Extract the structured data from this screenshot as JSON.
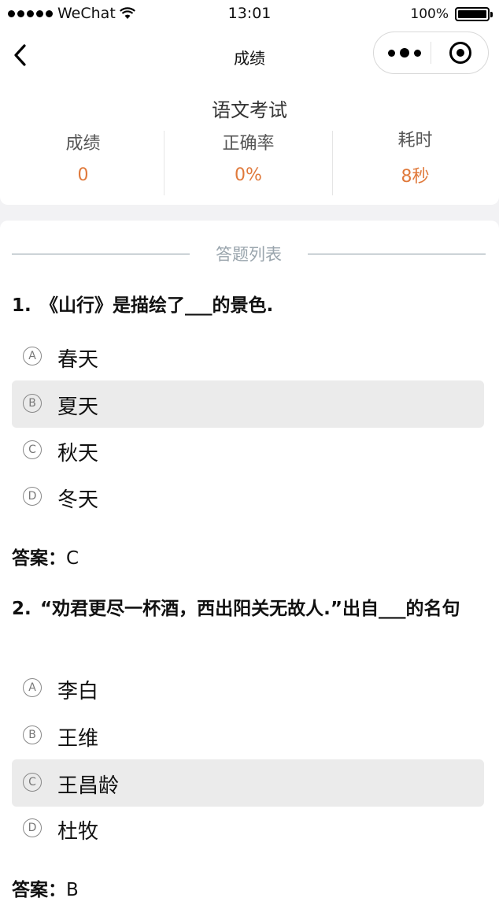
{
  "status_bar": {
    "carrier": "WeChat",
    "time": "13:01",
    "battery": "100%",
    "battery_level": 1.0
  },
  "nav": {
    "title": "成绩"
  },
  "summary": {
    "exam_title": "语文考试",
    "stats": [
      {
        "label": "成绩",
        "value": "0"
      },
      {
        "label": "正确率",
        "value": "0%"
      },
      {
        "label": "耗时",
        "value": "8秒"
      }
    ]
  },
  "list": {
    "section_title": "答题列表",
    "questions": [
      {
        "number": "1.",
        "text": "《山行》是描绘了___的景色.",
        "options": [
          {
            "letter": "A",
            "text": "春天"
          },
          {
            "letter": "B",
            "text": "夏天"
          },
          {
            "letter": "C",
            "text": "秋天"
          },
          {
            "letter": "D",
            "text": "冬天"
          }
        ],
        "selected": "B",
        "answer_label": "答案：",
        "answer": "C"
      },
      {
        "number": "2.",
        "text": "“劝君更尽一杯酒，西出阳关无故人.”出自___的名句",
        "options": [
          {
            "letter": "A",
            "text": "李白"
          },
          {
            "letter": "B",
            "text": "王维"
          },
          {
            "letter": "C",
            "text": "王昌龄"
          },
          {
            "letter": "D",
            "text": "杜牧"
          }
        ],
        "selected": "C",
        "answer_label": "答案：",
        "answer": "B"
      }
    ]
  },
  "colors": {
    "accent": "#e07a3c",
    "selected_bg": "#ebebeb",
    "divider": "#8a9aa4"
  }
}
